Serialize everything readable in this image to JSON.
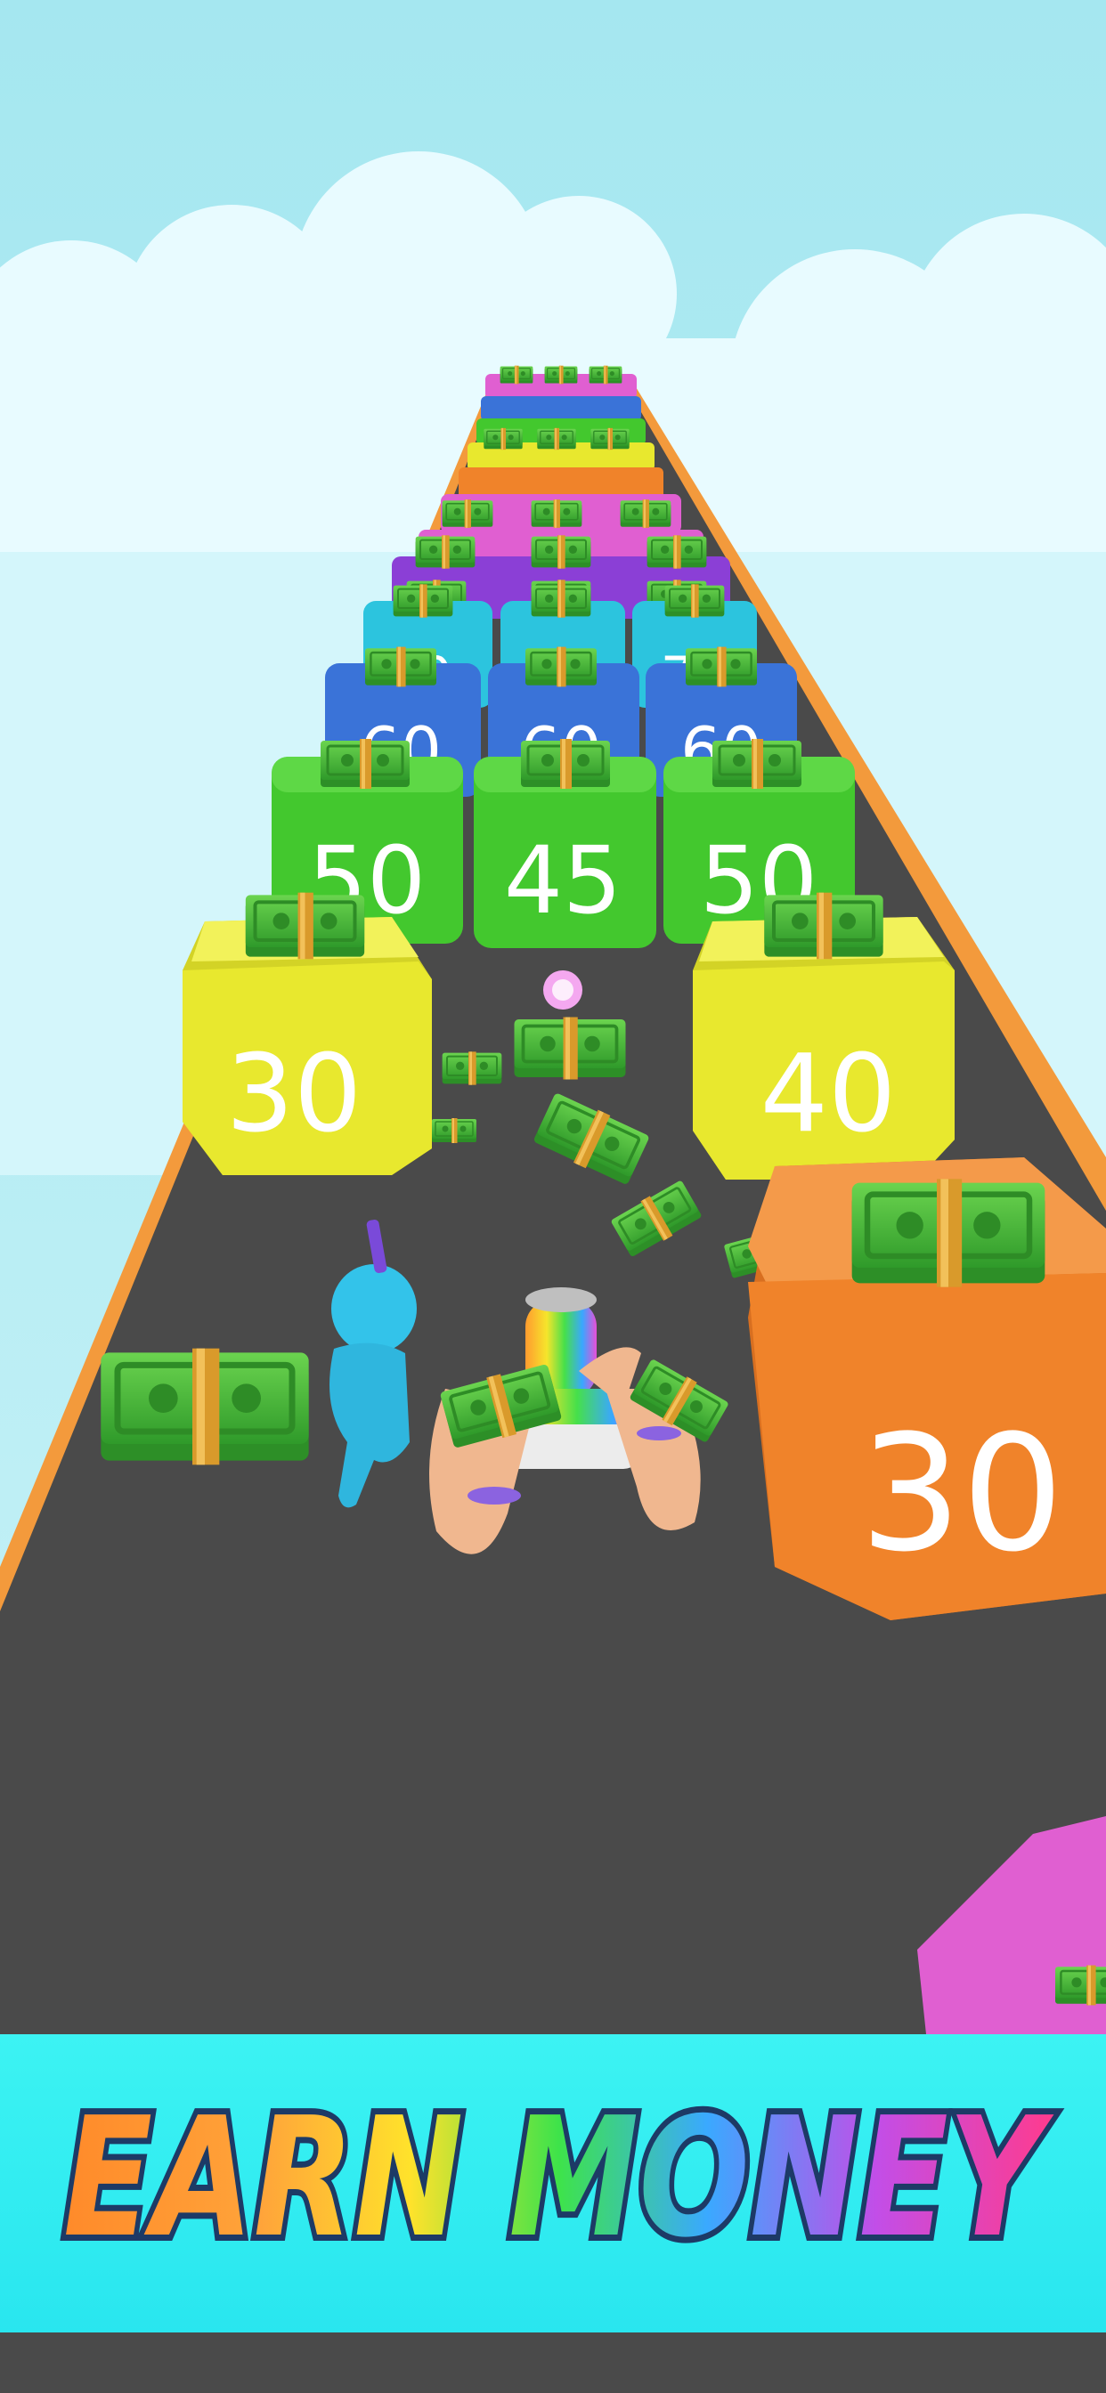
{
  "banner": {
    "title": "EARN MONEY"
  },
  "blocks": {
    "row_60_left": "60",
    "row_60_mid": "60",
    "row_60_right": "60",
    "row_70_left": "70",
    "row_70_right": "70",
    "row_50_left": "50",
    "row_45_mid": "45",
    "row_50_right": "50",
    "near_left": "30",
    "near_right": "40",
    "front_right": "30"
  },
  "colors": {
    "sky": "#aeeaf1",
    "road": "#4a4a4a",
    "road_edge": "#f7993a",
    "banner_bg": "#33eef2",
    "block_yellow": "#e8e82e",
    "block_green": "#43c82e",
    "block_blue": "#3a73d8",
    "block_cyan": "#2cc4de",
    "block_purple": "#8b3fd6",
    "block_pink": "#e05fd1",
    "block_orange": "#f0832a",
    "cash_green": "#47b83a",
    "cash_band": "#e0a030",
    "player_blue": "#33c3ea"
  },
  "icons": {
    "cash": "money-stack-icon",
    "runner": "stickman-runner-icon",
    "hands": "player-hands-icon"
  }
}
